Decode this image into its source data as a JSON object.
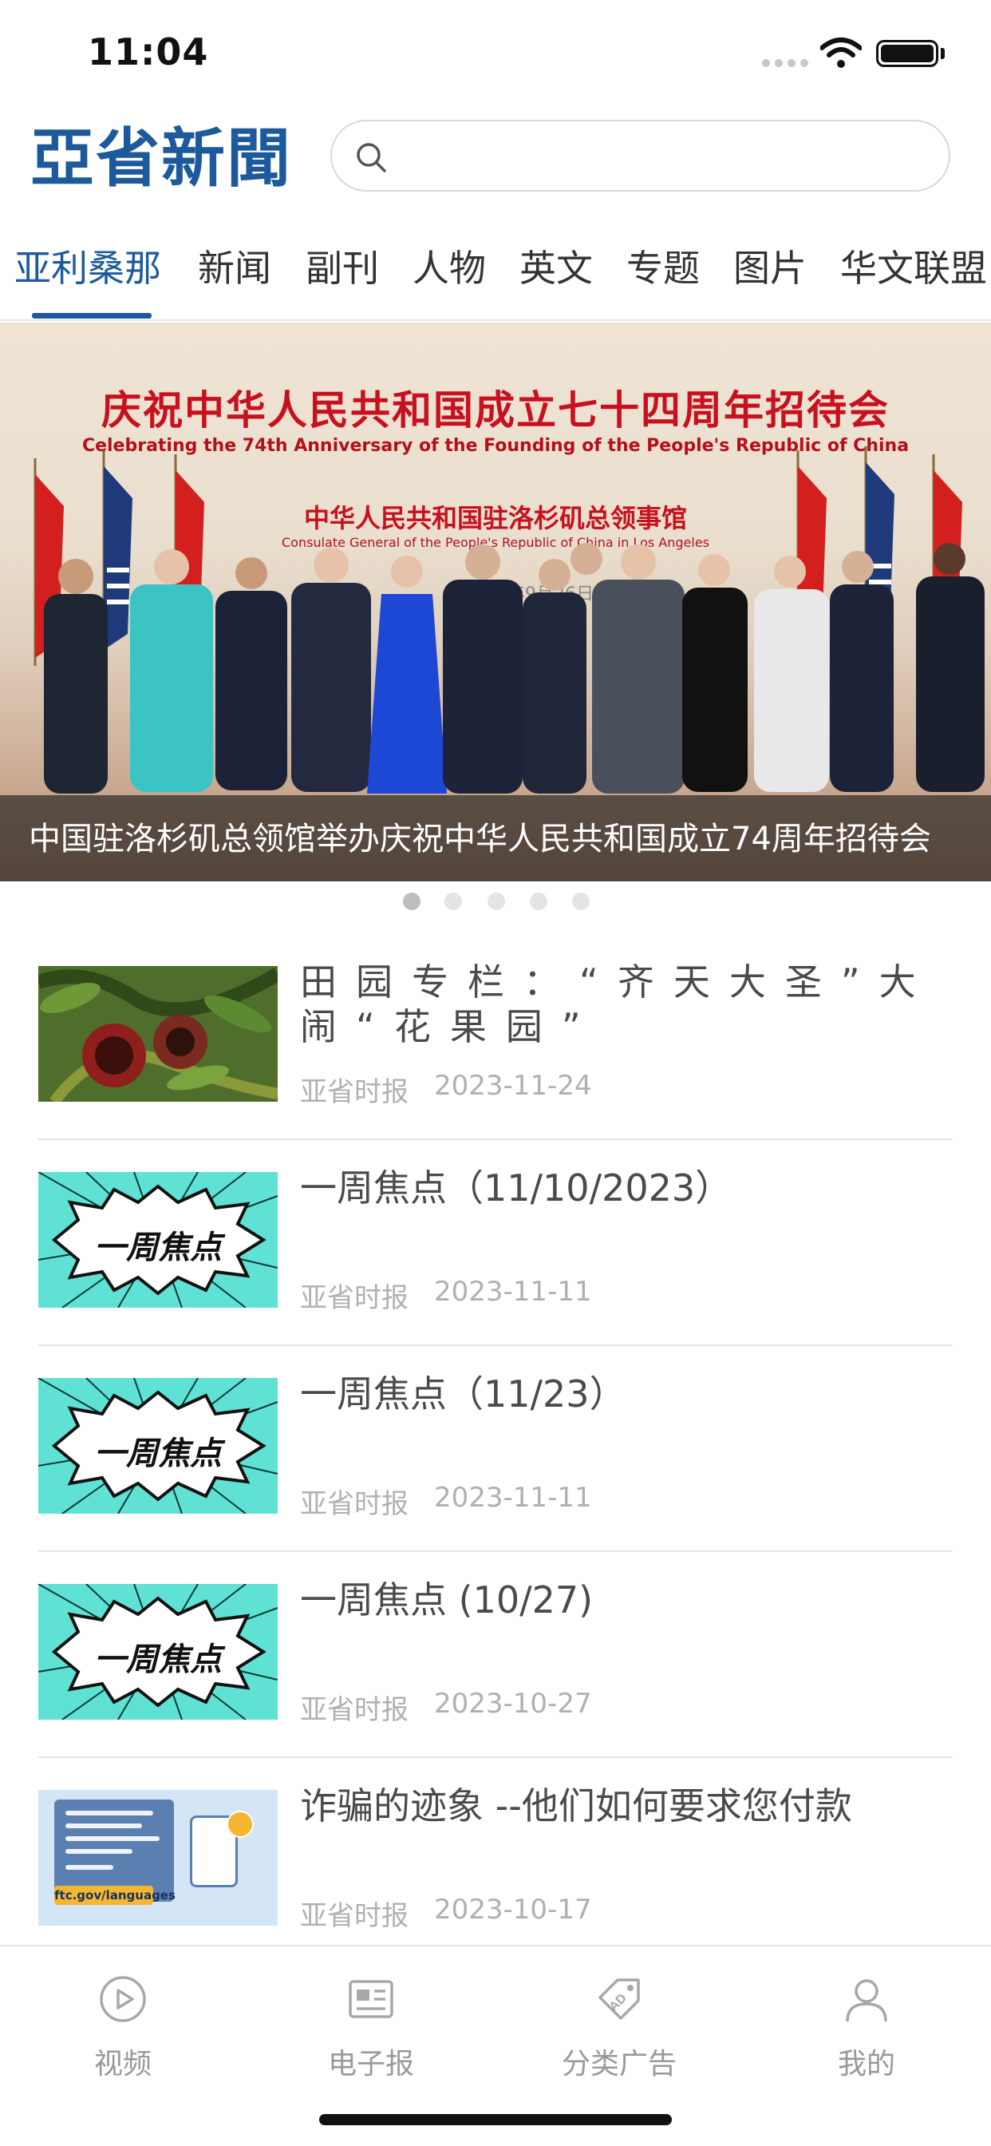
{
  "status_bar": {
    "time": "11:04"
  },
  "header": {
    "logo": "亞省新聞",
    "search": {
      "value": "",
      "placeholder": ""
    }
  },
  "tabs": [
    {
      "label": "亚利桑那",
      "active": true
    },
    {
      "label": "新闻",
      "active": false
    },
    {
      "label": "副刊",
      "active": false
    },
    {
      "label": "人物",
      "active": false
    },
    {
      "label": "英文",
      "active": false
    },
    {
      "label": "专题",
      "active": false
    },
    {
      "label": "图片",
      "active": false
    },
    {
      "label": "华文联盟",
      "active": false
    }
  ],
  "banner": {
    "headline": "庆祝中华人民共和国成立七十四周年招待会",
    "subheadline": "Celebrating the 74th Anniversary of the Founding of the People's Republic of China",
    "host": "中华人民共和国驻洛杉矶总领事馆",
    "host_en": "Consulate General of the People's Republic of China in Los Angeles",
    "date_fragment": "2023年9月26日",
    "caption": "中国驻洛杉矶总领馆举办庆祝中华人民共和国成立74周年招待会",
    "slide_count": 5,
    "active_slide": 1
  },
  "news": [
    {
      "title": "田园专栏：“齐天大圣”大闹“花果园”",
      "source": "亚省时报",
      "date": "2023-11-24",
      "thumb": "pomegranate-photo"
    },
    {
      "title": "一周焦点（11/10/2023）",
      "source": "亚省时报",
      "date": "2023-11-11",
      "thumb": "weekly-focus",
      "thumb_text": "一周焦点"
    },
    {
      "title": "一周焦点（11/23）",
      "source": "亚省时报",
      "date": "2023-11-11",
      "thumb": "weekly-focus",
      "thumb_text": "一周焦点"
    },
    {
      "title": "一周焦点 (10/27)",
      "source": "亚省时报",
      "date": "2023-10-27",
      "thumb": "weekly-focus",
      "thumb_text": "一周焦点"
    },
    {
      "title": "诈骗的迹象 --他们如何要求您付款",
      "source": "亚省时报",
      "date": "2023-10-17",
      "thumb": "ftc-scam-graphic",
      "thumb_text": "ftc.gov/languages"
    }
  ],
  "bottom_nav": [
    {
      "label": "视频",
      "icon": "play-circle-icon"
    },
    {
      "label": "电子报",
      "icon": "newspaper-icon"
    },
    {
      "label": "分类广告",
      "icon": "ad-tag-icon"
    },
    {
      "label": "我的",
      "icon": "user-icon"
    }
  ],
  "colors": {
    "brand": "#1c5a9c",
    "banner_red": "#c8101e",
    "focus_cyan": "#5fe2d3",
    "muted_text": "#b0b0b0"
  }
}
